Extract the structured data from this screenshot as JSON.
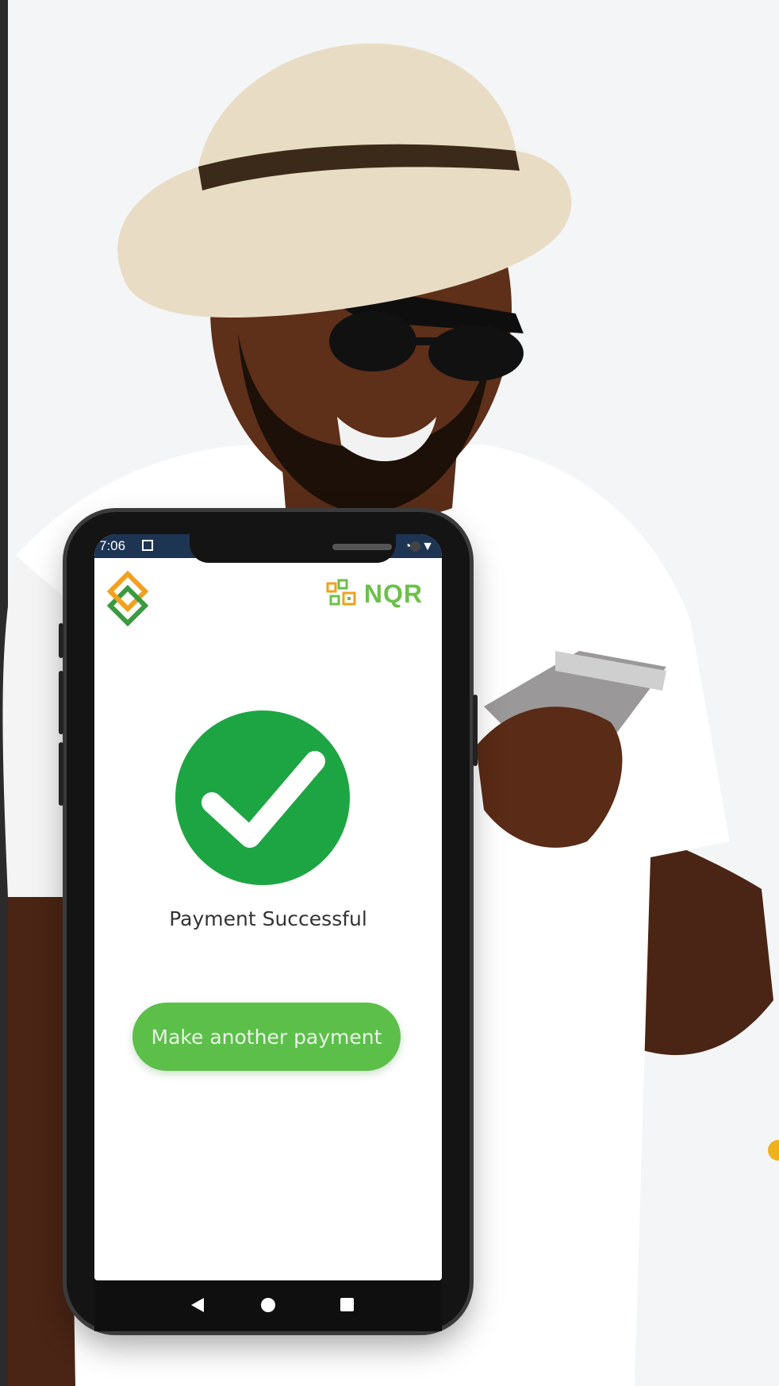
{
  "statusbar": {
    "time": "7:06",
    "right_icons": "⏰ ◔ ▼"
  },
  "app": {
    "brand_logo_icon": "interlocking-diamond-logo-icon",
    "nqr_label": "NQR",
    "success_message": "Payment Successful",
    "cta_label": "Make another payment",
    "colors": {
      "success_green": "#1ea543",
      "button_green": "#5cbf4a",
      "statusbar": "#1d3553"
    }
  },
  "navbar": {
    "back_icon": "back-triangle-icon",
    "home_icon": "home-circle-icon",
    "recents_icon": "recents-square-icon"
  }
}
